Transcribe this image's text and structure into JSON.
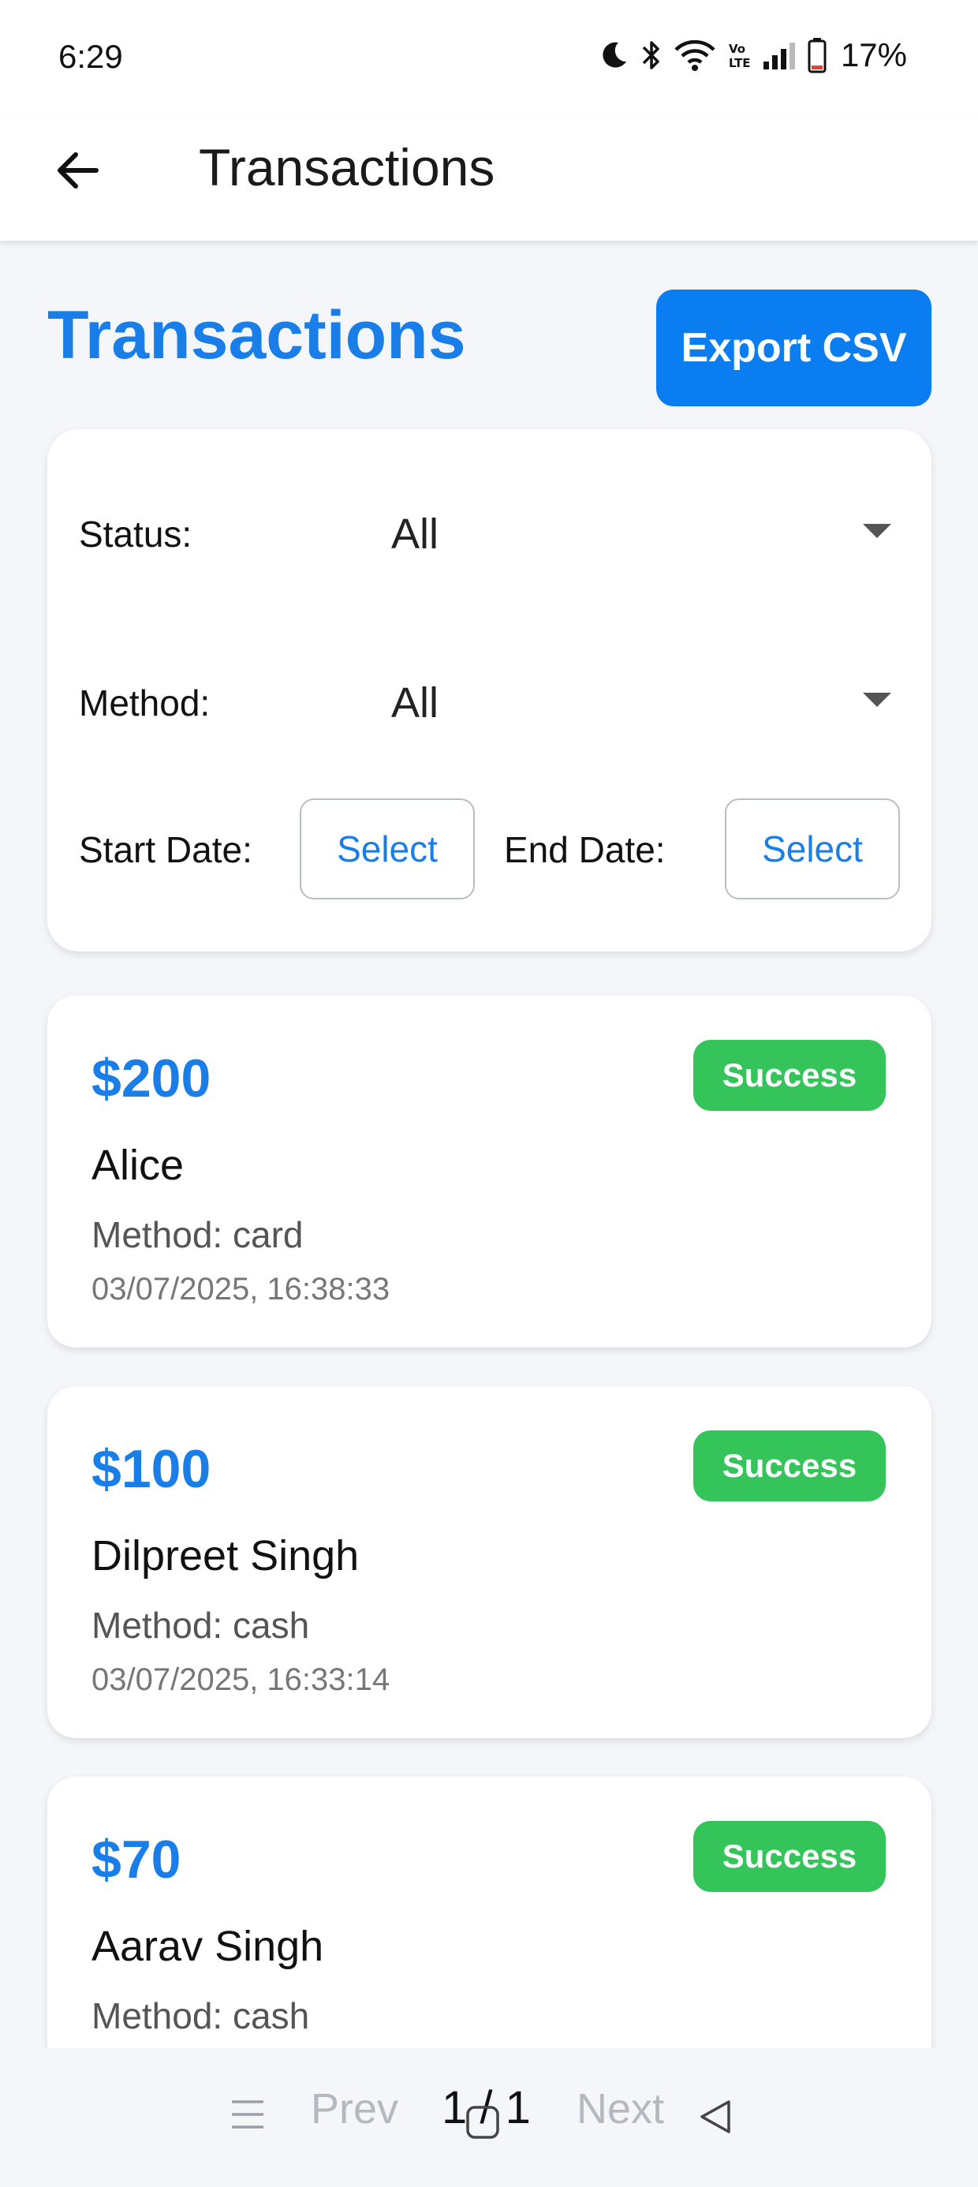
{
  "status_bar": {
    "time": "6:29",
    "battery_text": "17%",
    "icons": [
      "moon-icon",
      "bluetooth-icon",
      "wifi-icon",
      "volte-icon",
      "signal-icon",
      "battery-icon"
    ]
  },
  "app_bar": {
    "title": "Transactions",
    "back_icon": "arrow-left-icon"
  },
  "header": {
    "title": "Transactions",
    "export_label": "Export CSV"
  },
  "filters": {
    "status_label": "Status:",
    "status_value": "All",
    "method_label": "Method:",
    "method_value": "All",
    "start_date_label": "Start Date:",
    "start_date_button": "Select",
    "end_date_label": "End Date:",
    "end_date_button": "Select"
  },
  "transactions": [
    {
      "amount": "$200",
      "status": "Success",
      "name": "Alice",
      "method": "Method: card",
      "datetime": "03/07/2025, 16:38:33"
    },
    {
      "amount": "$100",
      "status": "Success",
      "name": "Dilpreet Singh",
      "method": "Method: cash",
      "datetime": "03/07/2025, 16:33:14"
    },
    {
      "amount": "$70",
      "status": "Success",
      "name": "Aarav Singh",
      "method": "Method: cash",
      "datetime": ""
    }
  ],
  "pagination": {
    "prev_label": "Prev",
    "indicator": "1 / 1",
    "next_label": "Next"
  },
  "colors": {
    "accent": "#1a7ee8",
    "button": "#0a7df0",
    "success": "#34c45a",
    "background": "#f4f6f9"
  }
}
